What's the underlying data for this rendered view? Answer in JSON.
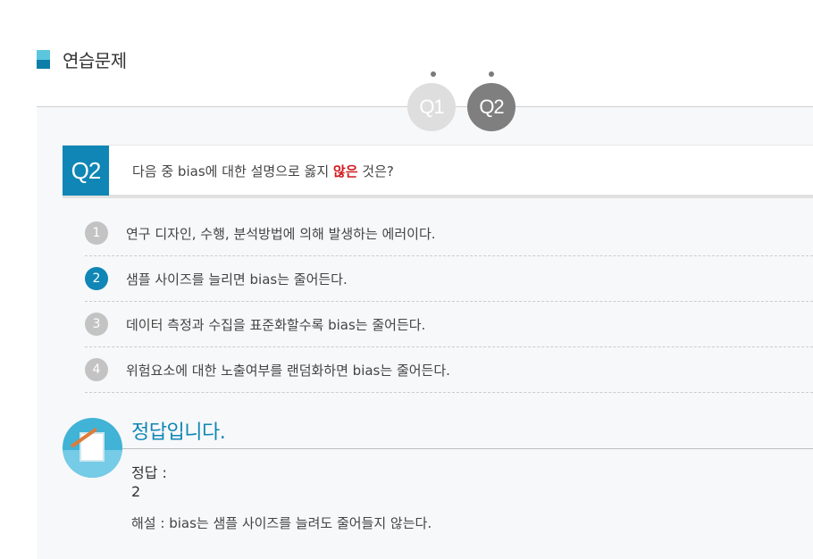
{
  "section": {
    "title": "연습문제"
  },
  "tabs": [
    {
      "label": "Q1",
      "active": false
    },
    {
      "label": "Q2",
      "active": true
    }
  ],
  "question": {
    "label": "Q2",
    "text_before": "다음 중 bias에 대한 설명으로 옳지 ",
    "text_emphasis": "않은",
    "text_after": " 것은?"
  },
  "options": [
    {
      "num": "1",
      "text": "연구 디자인, 수행, 분석방법에 의해 발생하는 에러이다.",
      "selected": false
    },
    {
      "num": "2",
      "text": "샘플 사이즈를 늘리면 bias는 줄어든다.",
      "selected": true
    },
    {
      "num": "3",
      "text": "데이터 측정과 수집을 표준화할수록 bias는 줄어든다.",
      "selected": false
    },
    {
      "num": "4",
      "text": "위험요소에 대한 노출여부를 랜덤화하면 bias는 줄어든다.",
      "selected": false
    }
  ],
  "answer": {
    "title": "정답입니다.",
    "label": "정답 :",
    "value": "2",
    "explanation": "해설 : bias는 샘플 사이즈를 늘려도 줄어들지 않는다."
  },
  "colors": {
    "accent": "#0f86b5",
    "emphasis": "#d0191c",
    "tab_active": "#7f7f7f",
    "tab_inactive": "#dedede"
  }
}
